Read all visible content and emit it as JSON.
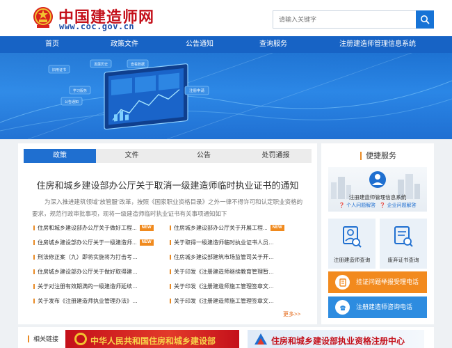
{
  "header": {
    "site_name": "中国建造师网",
    "site_url": "www.coc.gov.cn",
    "search_placeholder": "请输入关键字"
  },
  "nav": {
    "items": [
      "首页",
      "政策文件",
      "公告通知",
      "查询服务",
      "注册建造师管理信息系统"
    ]
  },
  "banner": {
    "labels": [
      "旧用证书",
      "发展历史",
      "查看数据",
      "学习服务",
      "公告通知",
      "注册申请"
    ]
  },
  "main": {
    "tabs": [
      "政策",
      "文件",
      "公告",
      "处罚通报"
    ],
    "active_tab": "政策",
    "headline": "住房和城乡建设部办公厅关于取消一级建造师临时执业证书的通知",
    "summary": "为深入推进建筑领域“放管服”改革，按照《国家职业资格目录》之外一律不得许可和认定职业资格的要求，规范行政审批事项，现将一级建造师临时执业证书有关事项通知如下",
    "news_left": [
      {
        "title": "住房和城乡建设部办公厅关于做好工程...",
        "badge": "NEW"
      },
      {
        "title": "住房城乡建设部办公厅关于一级建造师...",
        "badge": "NEW"
      },
      {
        "title": "刑法修正案（九）即将实施将为打击考试作弊...",
        "badge": ""
      },
      {
        "title": "住房城乡建设部办公厅关于做好取得建造师临...",
        "badge": ""
      },
      {
        "title": "关于对注册有效期满的一级建造师延续注册有...",
        "badge": ""
      },
      {
        "title": "关于发布《注册建造师执业管理办法》（试行...",
        "badge": ""
      }
    ],
    "news_right": [
      {
        "title": "住房城乡建设部办公厅关于开展工程...",
        "badge": "NEW"
      },
      {
        "title": "关于取得一级建造师临时执业证书人员延续注...",
        "badge": ""
      },
      {
        "title": "住房城乡建设部建筑市场监管司关于开展取得...",
        "badge": ""
      },
      {
        "title": "关于印发《注册建造师继续教育管理暂行办法...",
        "badge": ""
      },
      {
        "title": "关于印发《注册建造师施工管理签章文件（试...",
        "badge": ""
      },
      {
        "title": "关于印发《注册建造师施工管理签章文件目录...",
        "badge": ""
      }
    ],
    "more": "更多>>"
  },
  "sidebar": {
    "title": "便捷服务",
    "system_banner": {
      "title": "注册建造师管理信息系统",
      "link_personal": "个人问题解答",
      "link_company": "企业问题解答"
    },
    "tiles": [
      "注册建造师查询",
      "废弃证书查询"
    ],
    "report_button": "挂证问题举报受理电话",
    "consult_button": "注册建造师咨询电话"
  },
  "footer": {
    "links_label": "相关链接",
    "link_banners": [
      "中华人民共和国住房和城乡建设部",
      "住房和城乡建设部执业资格注册中心"
    ]
  },
  "colors": {
    "brand_red": "#c4101a",
    "nav_blue": "#1763c5",
    "accent_orange": "#f08a1e",
    "button_blue": "#2d8ce0"
  }
}
